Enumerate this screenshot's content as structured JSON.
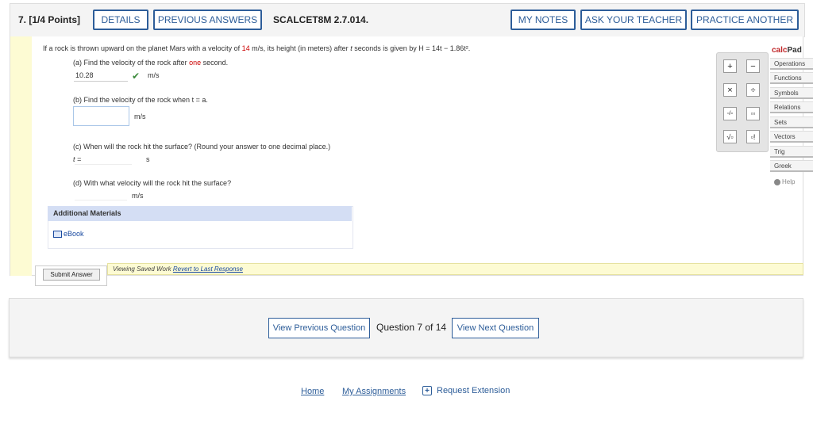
{
  "header": {
    "question_number": "7.",
    "points": "[1/4 Points]",
    "buttons": {
      "details": "DETAILS",
      "previous_answers": "PREVIOUS ANSWERS",
      "my_notes": "MY NOTES",
      "ask_teacher": "ASK YOUR TEACHER",
      "practice_another": "PRACTICE ANOTHER"
    },
    "code": "SCALCET8M 2.7.014."
  },
  "question": {
    "stem_pre": "If a rock is thrown upward on the planet Mars with a velocity of ",
    "stem_velocity": "14",
    "stem_mid": " m/s, its height (in meters) after ",
    "stem_t": "t",
    "stem_post": " seconds is given by ",
    "stem_formula": "H = 14t − 1.86t².",
    "part_a": {
      "label_pre": "(a) Find the velocity of the rock after ",
      "label_red": "one",
      "label_post": " second.",
      "answer": "10.28",
      "unit": "m/s"
    },
    "part_b": {
      "label": "(b) Find the velocity of the rock when t = a.",
      "value": "",
      "unit": "m/s"
    },
    "part_c": {
      "label": "(c) When will the rock hit the surface? (Round your answer to one decimal place.)",
      "prefix": "t =",
      "unit": "s"
    },
    "part_d": {
      "label": "(d) With what velocity will the rock hit the surface?",
      "unit": "m/s"
    }
  },
  "additional": {
    "title": "Additional Materials",
    "ebook": "eBook"
  },
  "saved_bar": {
    "text": "Viewing Saved Work ",
    "link": "Revert to Last Response"
  },
  "submit": "Submit Answer",
  "calcpad": {
    "title_calc": "calc",
    "title_pad": "Pad",
    "keys": [
      "+",
      "−",
      "×",
      "÷",
      "▫/▫",
      "▫▫",
      "√▫",
      "▫!"
    ],
    "tabs": [
      "Operations",
      "Functions",
      "Symbols",
      "Relations",
      "Sets",
      "Vectors",
      "Trig",
      "Greek"
    ],
    "help": "Help"
  },
  "nav": {
    "prev": "View Previous Question",
    "count": "Question 7 of 14",
    "next": "View Next Question"
  },
  "footer": {
    "home": "Home",
    "assignments": "My Assignments",
    "extension": "Request Extension"
  },
  "colors": {
    "accent": "#2d5d99",
    "correct": "#3a8a3a",
    "highlight": "#c00000"
  }
}
